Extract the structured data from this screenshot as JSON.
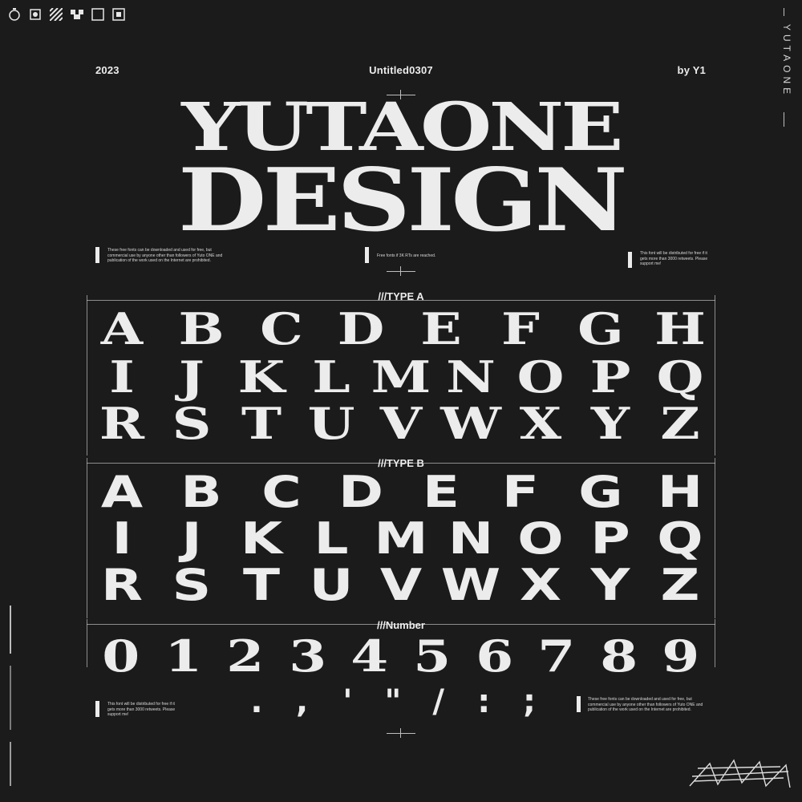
{
  "header": {
    "year": "2023",
    "title": "Untitled0307",
    "author": "by Y1"
  },
  "hero": {
    "line1": "YUTAONE",
    "line2": "DESIGN"
  },
  "notes": {
    "left_top": "These free fonts can be downloaded and used for free, but commercial use by anyone other than followers of Yuto ONE and publication of the work used on the Internet are prohibited.",
    "center_top": "Free fonts if 3K RTs are reached.",
    "right_top": "This font will be distributed for free if it gets more than 3000 retweets. Please support me!",
    "left_bottom": "This font will be distributed for free if it gets more than 3000 retweets. Please support me!",
    "right_bottom": "These free fonts can be downloaded and used for free, but commercial use by anyone other than followers of Yuto ONE and publication of the work used on the Internet are prohibited."
  },
  "sections": {
    "type_a": "///TYPE A",
    "type_b": "///TYPE B",
    "number": "///Number"
  },
  "type_a_rows": [
    [
      "A",
      "B",
      "C",
      "D",
      "E",
      "F",
      "G",
      "H"
    ],
    [
      "I",
      "J",
      "K",
      "L",
      "M",
      "N",
      "O",
      "P",
      "Q"
    ],
    [
      "R",
      "S",
      "T",
      "U",
      "V",
      "W",
      "X",
      "Y",
      "Z"
    ]
  ],
  "type_b_rows": [
    [
      "A",
      "B",
      "C",
      "D",
      "E",
      "F",
      "G",
      "H"
    ],
    [
      "I",
      "J",
      "K",
      "L",
      "M",
      "N",
      "O",
      "P",
      "Q"
    ],
    [
      "R",
      "S",
      "T",
      "U",
      "V",
      "W",
      "X",
      "Y",
      "Z"
    ]
  ],
  "numbers": [
    "0",
    "1",
    "2",
    "3",
    "4",
    "5",
    "6",
    "7",
    "8",
    "9"
  ],
  "punctuation": [
    ".",
    ",",
    "'",
    "\"",
    "/",
    ":",
    ";"
  ],
  "side_label": "YUTAONE",
  "icons": [
    "timer-icon",
    "gear-icon",
    "stripes-icon",
    "pixel-icon",
    "square-icon",
    "target-icon"
  ],
  "colors": {
    "background": "#1b1b1b",
    "foreground": "#ececec"
  }
}
